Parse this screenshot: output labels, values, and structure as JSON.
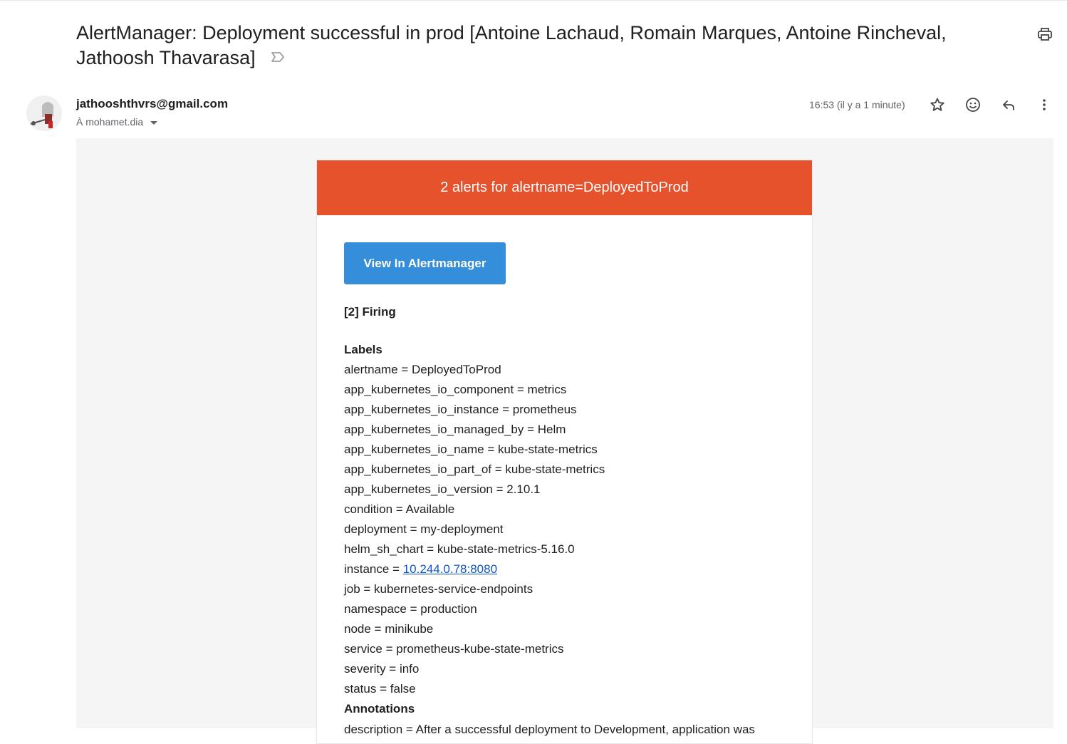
{
  "email": {
    "subject": "AlertManager: Deployment successful in prod [Antoine Lachaud, Romain Marques, Antoine Rincheval, Jathoosh Thavarasa]",
    "sender": "jathooshthvrs@gmail.com",
    "recipient": "À mohamet.dia",
    "time": "16:53 (il y a 1 minute)"
  },
  "icons": {
    "label": "label-important-icon",
    "print": "print-icon",
    "star": "star-icon",
    "emoji": "emoji-icon",
    "reply": "reply-icon",
    "more": "more-vert-icon"
  },
  "alert": {
    "header": "2 alerts for alertname=DeployedToProd",
    "header_color": "#e6522c",
    "button": "View In Alertmanager",
    "button_color": "#348eda",
    "firing": "[2] Firing",
    "labels_title": "Labels",
    "labels": [
      "alertname = DeployedToProd",
      "app_kubernetes_io_component = metrics",
      "app_kubernetes_io_instance = prometheus",
      "app_kubernetes_io_managed_by = Helm",
      "app_kubernetes_io_name = kube-state-metrics",
      "app_kubernetes_io_part_of = kube-state-metrics",
      "app_kubernetes_io_version = 2.10.1",
      "condition = Available",
      "deployment = my-deployment",
      "helm_sh_chart = kube-state-metrics-5.16.0"
    ],
    "instance_key": "instance = ",
    "instance_value": "10.244.0.78:8080",
    "labels_after": [
      "job = kubernetes-service-endpoints",
      "namespace = production",
      "node = minikube",
      "service = prometheus-kube-state-metrics",
      "severity = info",
      "status = false"
    ],
    "annotations_title": "Annotations",
    "annotation_row": "description = After a successful deployment to Development, application was"
  }
}
